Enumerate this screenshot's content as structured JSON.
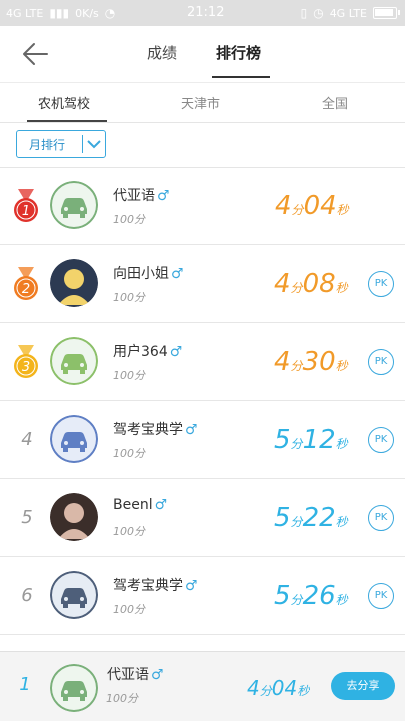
{
  "status_bar": {
    "left_text": "4G LTE",
    "net_speed": "0K/s",
    "time": "21:12",
    "right_text": "4G LTE"
  },
  "header": {
    "tabs": [
      {
        "label": "成绩"
      },
      {
        "label": "排行榜"
      }
    ]
  },
  "region_tabs": [
    {
      "label": "农机驾校"
    },
    {
      "label": "天津市"
    },
    {
      "label": "全国"
    }
  ],
  "filter": {
    "label": "月排行"
  },
  "units": {
    "minute": "分",
    "second": "秒"
  },
  "ranking": [
    {
      "rank": "1",
      "name": "代亚语",
      "gender": "♂",
      "score": "100分",
      "minutes": "4",
      "seconds": "04",
      "has_pk": false,
      "time_color": "#f19a29",
      "medal": "red"
    },
    {
      "rank": "2",
      "name": "向田小姐",
      "gender": "♂",
      "score": "100分",
      "minutes": "4",
      "seconds": "08",
      "has_pk": true,
      "time_color": "#f19a29",
      "medal": "orange"
    },
    {
      "rank": "3",
      "name": "用户364",
      "gender": "♂",
      "score": "100分",
      "minutes": "4",
      "seconds": "30",
      "has_pk": true,
      "time_color": "#f19a29",
      "medal": "gold"
    },
    {
      "rank": "4",
      "name": "驾考宝典学",
      "gender": "♂",
      "score": "100分",
      "minutes": "5",
      "seconds": "12",
      "has_pk": true,
      "time_color": "#2fb2e3"
    },
    {
      "rank": "5",
      "name": "Beenl",
      "gender": "♂",
      "score": "100分",
      "minutes": "5",
      "seconds": "22",
      "has_pk": true,
      "time_color": "#2fb2e3"
    },
    {
      "rank": "6",
      "name": "驾考宝典学",
      "gender": "♂",
      "score": "100分",
      "minutes": "5",
      "seconds": "26",
      "has_pk": true,
      "time_color": "#2fb2e3"
    }
  ],
  "pk_label": "PK",
  "my_rank": {
    "rank": "1",
    "name": "代亚语",
    "gender": "♂",
    "score": "100分",
    "minutes": "4",
    "seconds": "04",
    "share_label": "去分享"
  }
}
